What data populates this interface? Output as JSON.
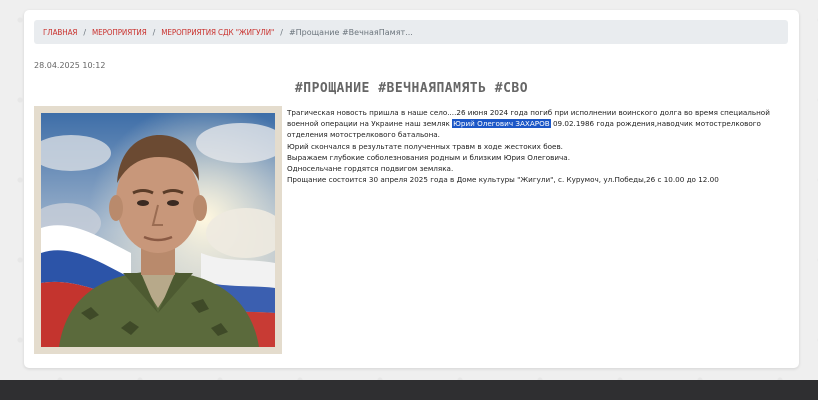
{
  "breadcrumb": {
    "items": [
      "ГЛАВНАЯ",
      "МЕРОПРИЯТИЯ",
      "МЕРОПРИЯТИЯ СДК \"ЖИГУЛИ\""
    ],
    "current": "#Прощание #ВечнаяПамят..."
  },
  "post": {
    "date": "28.04.2025 10:12",
    "title": "#ПРОЩАНИЕ #ВЕЧНАЯПАМЯТЬ #СВО",
    "p1_before": "Трагическая новость  пришла в наше село....26 июня  2024 года погиб при исполнении воинского долга во время специальной военной операции на Украине наш земляк ",
    "p1_highlight": "Юрий Олегович ЗАХАРОВ",
    "p1_after": " 09.02.1986  года рождения,наводчик мотострелкового отделения мотострелкового батальона.",
    "p2": "Юрий скончался в результате полученных травм в ходе жестоких боев.",
    "p3": "Выражаем глубокие соболезнования родным и близким Юрия Олеговича.",
    "p4": " Односельчане гордятся подвигом земляка.",
    "p5": "Прощание состоится 30 апреля 2025 года в Доме культуры \"Жигули\", с. Курумоч,  ул.Победы,26 с 10.00 до 12.00"
  },
  "colors": {
    "link": "#c9302c",
    "highlight": "#1c57c7",
    "footer": "#2f2f31"
  }
}
